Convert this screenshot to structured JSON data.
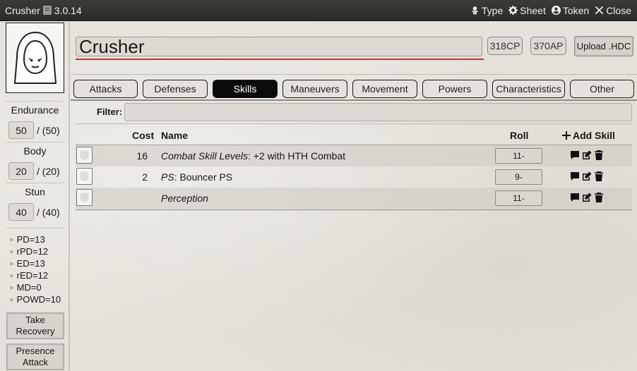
{
  "window": {
    "title": "Crusher",
    "version": "3.0.14",
    "controls": [
      {
        "label": "Type",
        "icon": "type-icon"
      },
      {
        "label": "Sheet",
        "icon": "gear-icon"
      },
      {
        "label": "Token",
        "icon": "user-circle-icon"
      },
      {
        "label": "Close",
        "icon": "close-icon"
      }
    ]
  },
  "sidebar": {
    "portrait_icon": "hooded-figure-icon",
    "endurance": {
      "label": "Endurance",
      "value": "50",
      "max": "/ (50)"
    },
    "body": {
      "label": "Body",
      "value": "20",
      "max": "/ (20)"
    },
    "stun": {
      "label": "Stun",
      "value": "40",
      "max": "/ (40)"
    },
    "defenses": [
      "PD=13",
      "rPD=12",
      "ED=13",
      "rED=12",
      "MD=0",
      "POWD=10"
    ],
    "take_recovery_line1": "Take",
    "take_recovery_line2": "Recovery",
    "presence_attack_line1": "Presence",
    "presence_attack_line2": "Attack"
  },
  "header": {
    "name": "Crusher",
    "cp": "318CP",
    "ap": "370AP",
    "upload_label": "Upload .HDC"
  },
  "tabs": [
    "Attacks",
    "Defenses",
    "Skills",
    "Maneuvers",
    "Movement",
    "Powers",
    "Characteristics",
    "Other"
  ],
  "active_tab": "Skills",
  "filter": {
    "label": "Filter:",
    "value": ""
  },
  "table": {
    "headers": {
      "cost": "Cost",
      "name": "Name",
      "roll": "Roll",
      "add": "Add Skill"
    },
    "rows": [
      {
        "cost": "16",
        "name_italic": "Combat Skill Levels",
        "name_rest": ": +2 with HTH Combat",
        "roll": "11-"
      },
      {
        "cost": "2",
        "name_italic": "PS",
        "name_rest": ": Bouncer PS",
        "roll": "9-"
      },
      {
        "cost": "",
        "name_italic": "Perception",
        "name_rest": "",
        "roll": "11-"
      }
    ]
  },
  "colors": {
    "titlebar": "#2f2f2c",
    "active_tab": "#0b0b0b",
    "name_underline": "#b23a2e",
    "background": "#e4e2da"
  }
}
